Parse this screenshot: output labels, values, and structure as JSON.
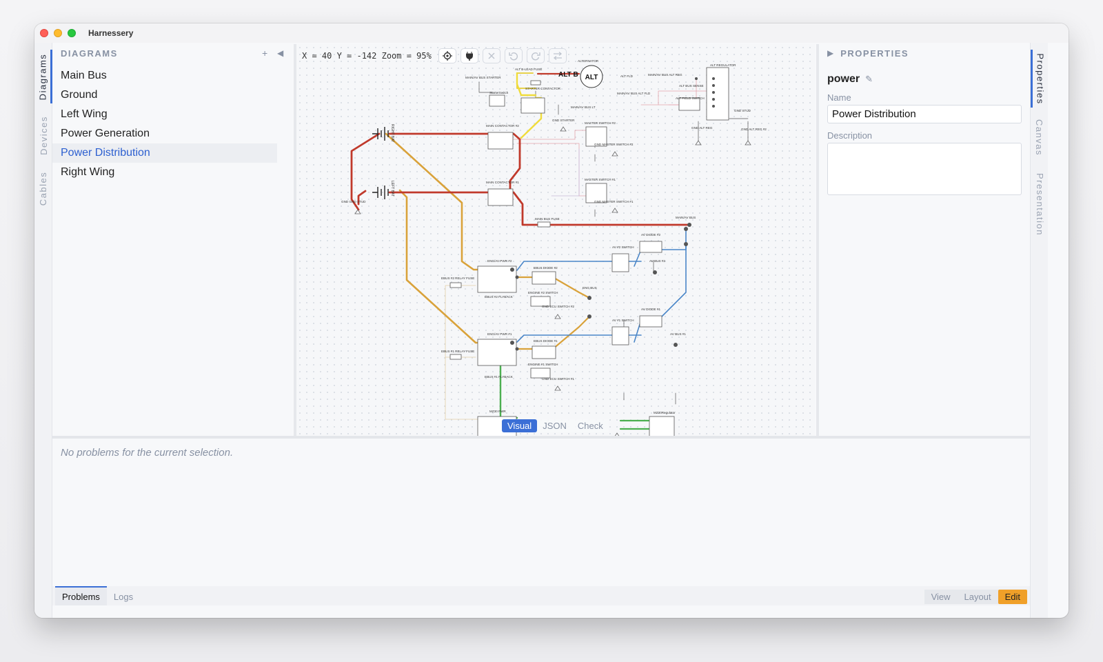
{
  "window": {
    "title": "Harnessery"
  },
  "left_tabs": [
    "Diagrams",
    "Devices",
    "Cables"
  ],
  "sidebar": {
    "title": "DIAGRAMS",
    "add_label": "+",
    "collapse_label": "◀",
    "items": [
      {
        "label": "Main Bus"
      },
      {
        "label": "Ground"
      },
      {
        "label": "Left Wing"
      },
      {
        "label": "Power Generation"
      },
      {
        "label": "Power Distribution",
        "selected": true
      },
      {
        "label": "Right Wing"
      }
    ]
  },
  "canvas": {
    "coords": "X = 40 Y = -142 Zoom = 95%",
    "toolbar_icons": [
      "locate-icon",
      "plug-icon",
      "close-icon",
      "undo-icon",
      "redo-icon",
      "swap-icon"
    ],
    "view_tabs": [
      "Visual",
      "JSON",
      "Check"
    ],
    "active_view": "Visual",
    "labels": {
      "alt_b": "ALT B",
      "alt": "ALT",
      "alternator": "ALTERNATOR",
      "alt_b_lead_fuse": "ALT B-LEAD FUSE",
      "alt_fld": "ALT FLD",
      "alt_bus_sense": "ALT BUS SENSE",
      "alt_regulator": "ALT REGULATOR",
      "alt_field_switch": "ALT FIELD SWITCH",
      "main_av_bus_starter": "MAIN/AV BUS STARTER",
      "main_av_bus_alt_reg": "MAIN/AV BUS ALT REG",
      "main_av_bus_alt_fld": "MAIN/AV BUS ALT FLD",
      "main_av_bus_lt": "MAIN/AV BUS LT",
      "starter_switch": "StarterSwitch",
      "starter_contactor": "STARTER CONTACTOR",
      "gnd_starter": "GND STARTER",
      "gnd_alt_reg": "GND ALT REG",
      "gnd_alt_reg_2": "GND ALT REG #2",
      "gnd_stud": "GND STUD",
      "right_bat": "RIGHT BAT",
      "left_bat": "LEFT BAT",
      "gnd_gnd_stud": "GND GND STUD",
      "main_contactor_2": "MAIN CONTACTOR #2",
      "main_contactor_1": "MAIN CONTACTOR #1",
      "master_switch_2": "MASTER SWITCH #2",
      "master_switch_1": "MASTER SWITCH #1",
      "gnd_master_switch_2": "GND MASTER SWITCH #2",
      "gnd_master_switch_1": "GND MASTER SWITCH #1",
      "main_bus_fuse": "MAIN BUS FUSE",
      "main_av_bus": "MAIN/AV BUS",
      "av_diode_2": "AV DIODE #2",
      "av_diode_1": "AV DIODE #1",
      "av_2_switch": "AV #2 SWITCH",
      "av_1_switch": "AV #1 SWITCH",
      "av_bus_2": "AV BUS #2",
      "av_bus_1": "AV BUS #1",
      "eng_av_pwr_2": "ENG/AV PWR #2",
      "eng_av_pwr_1": "ENG/AV PWR #1",
      "ebus_2_relay_fuse": "EBUS #2 RELAY FUSE",
      "ebus_1_relay_fuse": "EBUS #1 RELAY FUSE",
      "ebus_diode_2": "EBUS DIODE #2",
      "ebus_diode_1": "EBUS DIODE #1",
      "ebus_2_flyback": "EBUS #2 FLYBACK",
      "ebus_1_flyback": "EBUS #1 FLYBACK",
      "eng_bus": "ENG BUS",
      "engine_2_switch": "ENGINE #2 SWITCH",
      "engine_1_switch": "ENGINE #1 SWITCH",
      "gnd_ecu_switch_2": "GND ECU SWITCH #2",
      "gnd_ecu_switch_1": "GND ECU SWITCH #1",
      "mz30_pwr": "MZ30 PWR",
      "mz30_regulator": "MZ30Regulator"
    }
  },
  "properties": {
    "title": "PROPERTIES",
    "expand_label": "▶",
    "entity": "power",
    "edit_icon": "✎",
    "name_label": "Name",
    "name_value": "Power Distribution",
    "description_label": "Description",
    "description_value": ""
  },
  "right_tabs": [
    "Properties",
    "Canvas",
    "Presentation"
  ],
  "problems": {
    "message": "No problems for the current selection.",
    "tabs": [
      "Problems",
      "Logs"
    ],
    "active_tab": "Problems"
  },
  "modes": {
    "items": [
      "View",
      "Layout",
      "Edit"
    ],
    "active": "Edit"
  }
}
